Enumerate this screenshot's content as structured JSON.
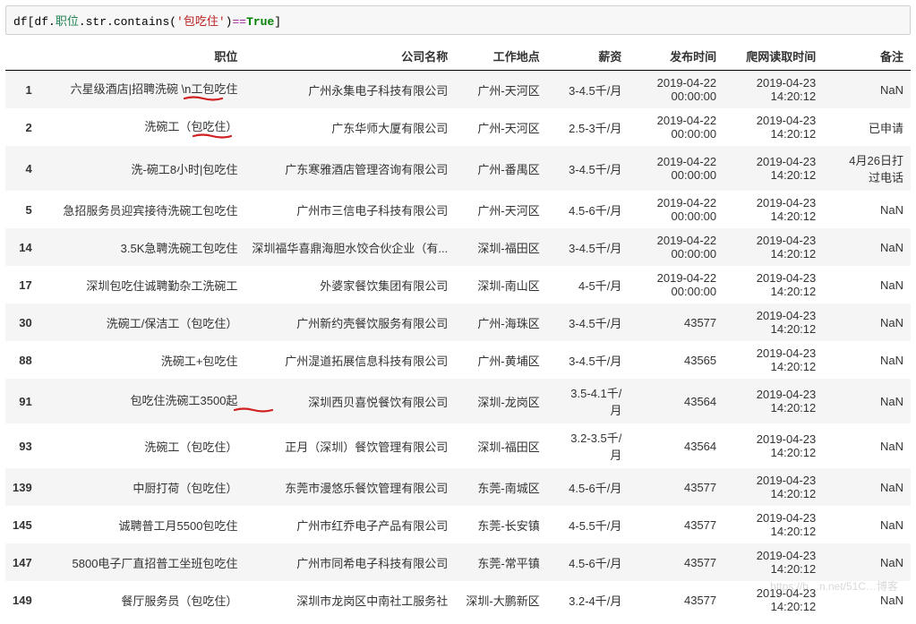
{
  "code": {
    "prefix": "df[df.",
    "field": "职位",
    "method": ".str.contains(",
    "arg": "'包吃住'",
    "close": ")",
    "eq": "==",
    "bool": "True",
    "end": "]"
  },
  "headers": {
    "index": "",
    "pos": "职位",
    "company": "公司名称",
    "loc": "工作地点",
    "salary": "薪资",
    "pub": "发布时间",
    "crawl": "爬网读取时间",
    "remark": "备注"
  },
  "rows": [
    {
      "idx": "1",
      "pos": "六星级酒店|招聘洗碗 \\n工包吃住",
      "company": "广州永集电子科技有限公司",
      "loc": "广州-天河区",
      "salary": "3-4.5千/月",
      "pub": "2019-04-22 00:00:00",
      "crawl": "2019-04-23 14:20:12",
      "remark": "NaN",
      "underline": true,
      "ul_offset": "176"
    },
    {
      "idx": "2",
      "pos": "洗碗工（包吃住）",
      "company": "广东华师大厦有限公司",
      "loc": "广州-天河区",
      "salary": "2.5-3千/月",
      "pub": "2019-04-22 00:00:00",
      "crawl": "2019-04-23 14:20:12",
      "remark": "已申请",
      "underline": true,
      "ul_offset": "166"
    },
    {
      "idx": "4",
      "pos": "洗-碗工8小时|包吃住",
      "company": "广东寒雅酒店管理咨询有限公司",
      "loc": "广州-番禺区",
      "salary": "3-4.5千/月",
      "pub": "2019-04-22 00:00:00",
      "crawl": "2019-04-23 14:20:12",
      "remark": "4月26日打过电话",
      "underline": false
    },
    {
      "idx": "5",
      "pos": "急招服务员迎宾接待洗碗工包吃住",
      "company": "广州市三信电子科技有限公司",
      "loc": "广州-天河区",
      "salary": "4.5-6千/月",
      "pub": "2019-04-22 00:00:00",
      "crawl": "2019-04-23 14:20:12",
      "remark": "NaN",
      "underline": false
    },
    {
      "idx": "14",
      "pos": "3.5K急聘洗碗工包吃住",
      "company": "深圳福华喜鼎海胆水饺合伙企业（有...",
      "loc": "深圳-福田区",
      "salary": "3-4.5千/月",
      "pub": "2019-04-22 00:00:00",
      "crawl": "2019-04-23 14:20:12",
      "remark": "NaN",
      "underline": false
    },
    {
      "idx": "17",
      "pos": "深圳包吃住诚聘勤杂工洗碗工",
      "company": "外婆家餐饮集团有限公司",
      "loc": "深圳-南山区",
      "salary": "4-5千/月",
      "pub": "2019-04-22 00:00:00",
      "crawl": "2019-04-23 14:20:12",
      "remark": "NaN",
      "underline": false
    },
    {
      "idx": "30",
      "pos": "洗碗工/保洁工（包吃住）",
      "company": "广州新约壳餐饮服务有限公司",
      "loc": "广州-海珠区",
      "salary": "3-4.5千/月",
      "pub": "43577",
      "crawl": "2019-04-23 14:20:12",
      "remark": "NaN",
      "underline": false
    },
    {
      "idx": "88",
      "pos": "洗碗工+包吃住",
      "company": "广州湜道拓展信息科技有限公司",
      "loc": "广州-黄埔区",
      "salary": "3-4.5千/月",
      "pub": "43565",
      "crawl": "2019-04-23 14:20:12",
      "remark": "NaN",
      "underline": false
    },
    {
      "idx": "91",
      "pos": "包吃住洗碗工3500起",
      "company": "深圳西贝喜悦餐饮有限公司",
      "loc": "深圳-龙岗区",
      "salary": "3.5-4.1千/月",
      "pub": "43564",
      "crawl": "2019-04-23 14:20:12",
      "remark": "NaN",
      "underline": true,
      "ul_offset": "120"
    },
    {
      "idx": "93",
      "pos": "洗碗工（包吃住）",
      "company": "正月（深圳）餐饮管理有限公司",
      "loc": "深圳-福田区",
      "salary": "3.2-3.5千/月",
      "pub": "43564",
      "crawl": "2019-04-23 14:20:12",
      "remark": "NaN",
      "underline": false
    },
    {
      "idx": "139",
      "pos": "中厨打荷（包吃住）",
      "company": "东莞市漫悠乐餐饮管理有限公司",
      "loc": "东莞-南城区",
      "salary": "4.5-6千/月",
      "pub": "43577",
      "crawl": "2019-04-23 14:20:12",
      "remark": "NaN",
      "underline": false
    },
    {
      "idx": "145",
      "pos": "诚聘普工月5500包吃住",
      "company": "广州市红乔电子产品有限公司",
      "loc": "东莞-长安镇",
      "salary": "4-5.5千/月",
      "pub": "43577",
      "crawl": "2019-04-23 14:20:12",
      "remark": "NaN",
      "underline": false
    },
    {
      "idx": "147",
      "pos": "5800电子厂直招普工坐班包吃住",
      "company": "广州市同希电子科技有限公司",
      "loc": "东莞-常平镇",
      "salary": "4.5-6千/月",
      "pub": "43577",
      "crawl": "2019-04-23 14:20:12",
      "remark": "NaN",
      "underline": false
    },
    {
      "idx": "149",
      "pos": "餐厅服务员（包吃住）",
      "company": "深圳市龙岗区中南社工服务社",
      "loc": "深圳-大鹏新区",
      "salary": "3.2-4千/月",
      "pub": "43577",
      "crawl": "2019-04-23 14:20:12",
      "remark": "NaN",
      "underline": false
    }
  ],
  "watermark": "https://b…n.net/51C…博客"
}
